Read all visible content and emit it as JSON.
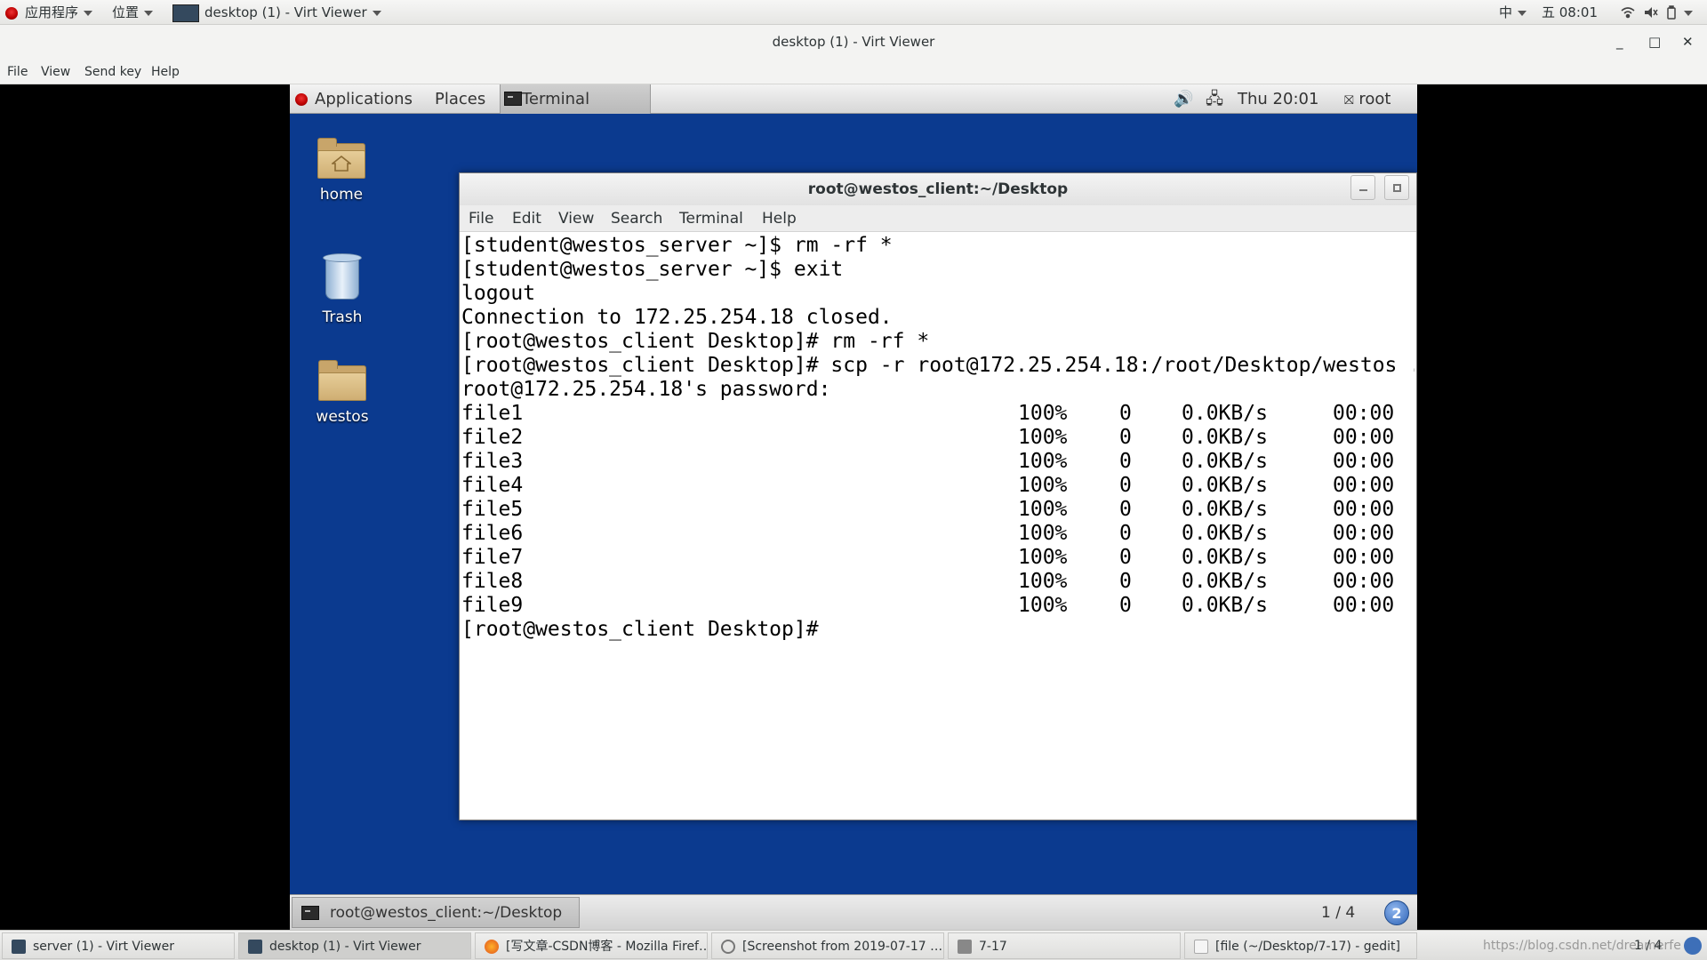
{
  "host_panel": {
    "applications": "应用程序",
    "places": "位置",
    "active_window": "desktop (1) - Virt Viewer",
    "input_method": "中",
    "clock": "五 08:01"
  },
  "viewer": {
    "title": "desktop (1) - Virt Viewer",
    "menu": [
      "File",
      "View",
      "Send key",
      "Help"
    ]
  },
  "guest_panel": {
    "applications": "Applications",
    "places": "Places",
    "terminal": "Terminal",
    "clock": "Thu 20:01",
    "user": "root"
  },
  "desktop_icons": [
    {
      "label": "home",
      "icon": "home-folder-icon"
    },
    {
      "label": "Trash",
      "icon": "trash-icon"
    },
    {
      "label": "westos",
      "icon": "folder-icon"
    }
  ],
  "terminal": {
    "title": "root@westos_client:~/Desktop",
    "menu": [
      "File",
      "Edit",
      "View",
      "Search",
      "Terminal",
      "Help"
    ],
    "lines": [
      "[student@westos_server ~]$ rm -rf *",
      "[student@westos_server ~]$ exit",
      "logout",
      "Connection to 172.25.254.18 closed.",
      "[root@westos_client Desktop]# rm -rf *",
      "[root@westos_client Desktop]# scp -r root@172.25.254.18:/root/Desktop/westos .",
      "root@172.25.254.18's password:"
    ],
    "transfers": [
      {
        "file": "file1",
        "pct": "100%",
        "size": "0",
        "rate": "0.0KB/s",
        "time": "00:00"
      },
      {
        "file": "file2",
        "pct": "100%",
        "size": "0",
        "rate": "0.0KB/s",
        "time": "00:00"
      },
      {
        "file": "file3",
        "pct": "100%",
        "size": "0",
        "rate": "0.0KB/s",
        "time": "00:00"
      },
      {
        "file": "file4",
        "pct": "100%",
        "size": "0",
        "rate": "0.0KB/s",
        "time": "00:00"
      },
      {
        "file": "file5",
        "pct": "100%",
        "size": "0",
        "rate": "0.0KB/s",
        "time": "00:00"
      },
      {
        "file": "file6",
        "pct": "100%",
        "size": "0",
        "rate": "0.0KB/s",
        "time": "00:00"
      },
      {
        "file": "file7",
        "pct": "100%",
        "size": "0",
        "rate": "0.0KB/s",
        "time": "00:00"
      },
      {
        "file": "file8",
        "pct": "100%",
        "size": "0",
        "rate": "0.0KB/s",
        "time": "00:00"
      },
      {
        "file": "file9",
        "pct": "100%",
        "size": "0",
        "rate": "0.0KB/s",
        "time": "00:00"
      }
    ],
    "final_prompt": "[root@westos_client Desktop]#"
  },
  "guest_bottom": {
    "task": "root@westos_client:~/Desktop",
    "pager": "1 / 4",
    "help": "2"
  },
  "host_taskbar": {
    "items": [
      {
        "label": "server (1) - Virt Viewer",
        "icon": "virt-viewer-icon"
      },
      {
        "label": "desktop (1) - Virt Viewer",
        "icon": "virt-viewer-icon"
      },
      {
        "label": "[写文章-CSDN博客 - Mozilla Firef…",
        "icon": "firefox-icon"
      },
      {
        "label": "[Screenshot from 2019-07-17 …",
        "icon": "image-viewer-icon"
      },
      {
        "label": "7-17",
        "icon": "file-manager-icon"
      },
      {
        "label": "[file (~/Desktop/7-17) - gedit]",
        "icon": "gedit-icon"
      }
    ],
    "watermark": "https://blog.csdn.net/dreamerfe",
    "pager": "1 / 4"
  },
  "colors": {
    "guest_desktop": "#0b3a8f",
    "accent_red": "#cc0000"
  }
}
